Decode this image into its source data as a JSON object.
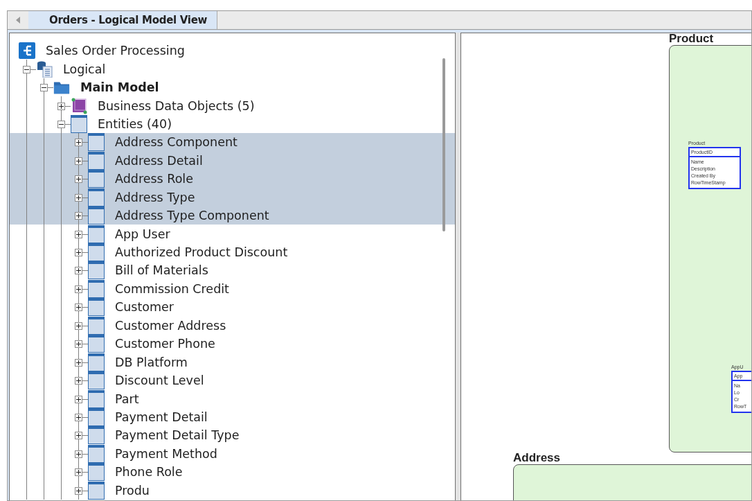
{
  "tab": {
    "label": "Orders - Logical Model View",
    "selected": true
  },
  "tree": {
    "label": "Sales Order Processing",
    "kind": "project",
    "selected": false,
    "children": [
      {
        "label": "Logical",
        "kind": "logical",
        "expanded": true,
        "selected": false,
        "children": [
          {
            "label": "Main Model",
            "kind": "model",
            "expanded": true,
            "selected": false,
            "children": [
              {
                "label": "Business Data Objects (5)",
                "kind": "bdo",
                "expanded": false,
                "selected": false
              },
              {
                "label": "Entities (40)",
                "kind": "entity",
                "expanded": true,
                "selected": false,
                "children": [
                  {
                    "label": "Address Component",
                    "kind": "entity",
                    "expanded": false,
                    "selected": true
                  },
                  {
                    "label": "Address Detail",
                    "kind": "entity",
                    "expanded": false,
                    "selected": true
                  },
                  {
                    "label": "Address Role",
                    "kind": "entity",
                    "expanded": false,
                    "selected": true
                  },
                  {
                    "label": "Address Type",
                    "kind": "entity",
                    "expanded": false,
                    "selected": true
                  },
                  {
                    "label": "Address Type Component",
                    "kind": "entity",
                    "expanded": false,
                    "selected": true
                  },
                  {
                    "label": "App User",
                    "kind": "entity",
                    "expanded": false,
                    "selected": false
                  },
                  {
                    "label": "Authorized Product Discount",
                    "kind": "entity",
                    "expanded": false,
                    "selected": false
                  },
                  {
                    "label": "Bill of Materials",
                    "kind": "entity",
                    "expanded": false,
                    "selected": false
                  },
                  {
                    "label": "Commission Credit",
                    "kind": "entity",
                    "expanded": false,
                    "selected": false
                  },
                  {
                    "label": "Customer",
                    "kind": "entity",
                    "expanded": false,
                    "selected": false
                  },
                  {
                    "label": "Customer Address",
                    "kind": "entity",
                    "expanded": false,
                    "selected": false
                  },
                  {
                    "label": "Customer Phone",
                    "kind": "entity",
                    "expanded": false,
                    "selected": false
                  },
                  {
                    "label": "DB Platform",
                    "kind": "entity",
                    "expanded": false,
                    "selected": false
                  },
                  {
                    "label": "Discount Level",
                    "kind": "entity",
                    "expanded": false,
                    "selected": false
                  },
                  {
                    "label": "Part",
                    "kind": "entity",
                    "expanded": false,
                    "selected": false
                  },
                  {
                    "label": "Payment Detail",
                    "kind": "entity",
                    "expanded": false,
                    "selected": false
                  },
                  {
                    "label": "Payment Detail Type",
                    "kind": "entity",
                    "expanded": false,
                    "selected": false
                  },
                  {
                    "label": "Payment Method",
                    "kind": "entity",
                    "expanded": false,
                    "selected": false
                  },
                  {
                    "label": "Phone Role",
                    "kind": "entity",
                    "expanded": false,
                    "selected": false
                  },
                  {
                    "label": "Produ",
                    "kind": "entity",
                    "expanded": false,
                    "selected": false
                  }
                ]
              }
            ]
          }
        ]
      }
    ]
  },
  "diagram": {
    "groups": [
      {
        "title": "Product",
        "entities": [
          {
            "name": "Product",
            "key": "ProductID",
            "fields": [
              "Name",
              "Description",
              "Created By",
              "RowTimeStamp"
            ]
          },
          {
            "name": "AppU",
            "key": "App",
            "fields": [
              "Na",
              "Lo",
              "Cr",
              "RowT"
            ]
          }
        ]
      },
      {
        "title": "Address"
      }
    ]
  }
}
